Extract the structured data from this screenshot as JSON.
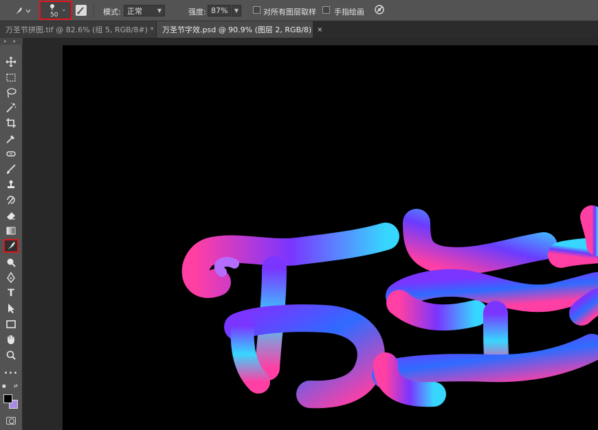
{
  "options_bar": {
    "brush_size": "50",
    "mode_label": "模式:",
    "mode_value": "正常",
    "strength_label": "强度:",
    "strength_value": "87%",
    "sample_all_layers_label": "对所有图层取样",
    "finger_painting_label": "手指绘画",
    "icons": [
      "smudge-tool-icon",
      "chevron-down-icon",
      "brush-panel-icon",
      "sample-target-icon"
    ]
  },
  "tabs": [
    {
      "label": "万圣节拼图.tif @ 82.6% (组 5, RGB/8#) *",
      "active": false
    },
    {
      "label": "万圣节字效.psd @ 90.9% (图层 2, RGB/8)",
      "active": true,
      "close": "×"
    }
  ],
  "toolbar": {
    "tools": [
      "move-tool",
      "marquee-tool",
      "lasso-tool",
      "magic-wand-tool",
      "crop-tool",
      "eyedropper-tool",
      "healing-brush-tool",
      "brush-tool",
      "clone-stamp-tool",
      "history-brush-tool",
      "eraser-tool",
      "gradient-tool",
      "smudge-tool",
      "dodge-tool",
      "pen-tool",
      "type-tool",
      "path-selection-tool",
      "rectangle-tool",
      "hand-tool",
      "zoom-tool",
      "more-tools"
    ],
    "type_glyph": "T",
    "more_glyph": "•••",
    "selected_tool": "smudge-tool",
    "foreground_color": "#000000",
    "background_color": "#a98be6"
  },
  "colors": {
    "accent_highlight": "#e0141b",
    "artwork_pink": "#ff3fa4",
    "artwork_purple": "#7a35ff",
    "artwork_blue": "#2f6bff",
    "artwork_cyan": "#37d6ff"
  }
}
